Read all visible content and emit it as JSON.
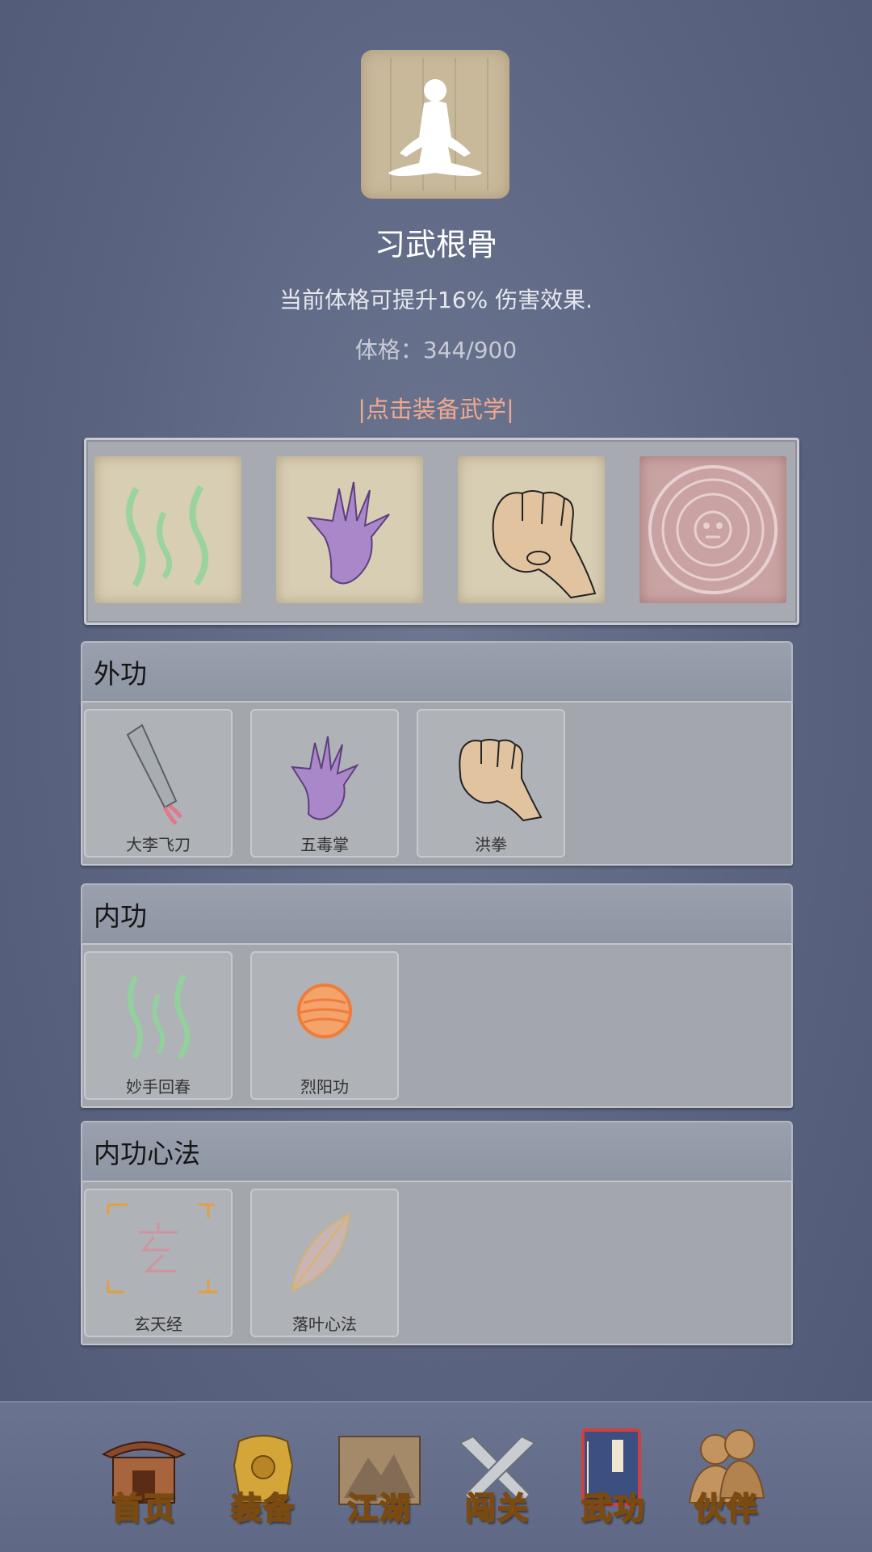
{
  "header": {
    "title": "习武根骨",
    "description": "当前体格可提升16% 伤害效果.",
    "stat": "体格：344/900",
    "equip_prompt": "|点击装备武学|"
  },
  "equipped_slots": [
    {
      "icon": "green-qi-icon"
    },
    {
      "icon": "purple-palm-icon"
    },
    {
      "icon": "fist-icon"
    },
    {
      "icon": "aztec-seal-icon"
    }
  ],
  "sections": [
    {
      "title": "外功",
      "skills": [
        {
          "name": "大李飞刀",
          "icon": "flying-blade-icon"
        },
        {
          "name": "五毒掌",
          "icon": "purple-palm-icon"
        },
        {
          "name": "洪拳",
          "icon": "fist-icon"
        }
      ]
    },
    {
      "title": "内功",
      "skills": [
        {
          "name": "妙手回春",
          "icon": "green-qi-icon"
        },
        {
          "name": "烈阳功",
          "icon": "sun-orb-icon"
        }
      ]
    },
    {
      "title": "内功心法",
      "skills": [
        {
          "name": "玄天经",
          "icon": "xuan-scroll-icon"
        },
        {
          "name": "落叶心法",
          "icon": "leaf-icon"
        }
      ]
    }
  ],
  "bottom_nav": [
    {
      "label": "首页",
      "icon": "temple-icon"
    },
    {
      "label": "装备",
      "icon": "armor-icon"
    },
    {
      "label": "江湖",
      "icon": "mountain-scroll-icon"
    },
    {
      "label": "闯关",
      "icon": "crossed-swords-icon"
    },
    {
      "label": "武功",
      "icon": "martial-book-icon"
    },
    {
      "label": "伙伴",
      "icon": "companions-icon"
    }
  ],
  "colors": {
    "background": "#5a6380",
    "equip_prompt": "#f0a890",
    "nav_label": "#f4c23a"
  }
}
